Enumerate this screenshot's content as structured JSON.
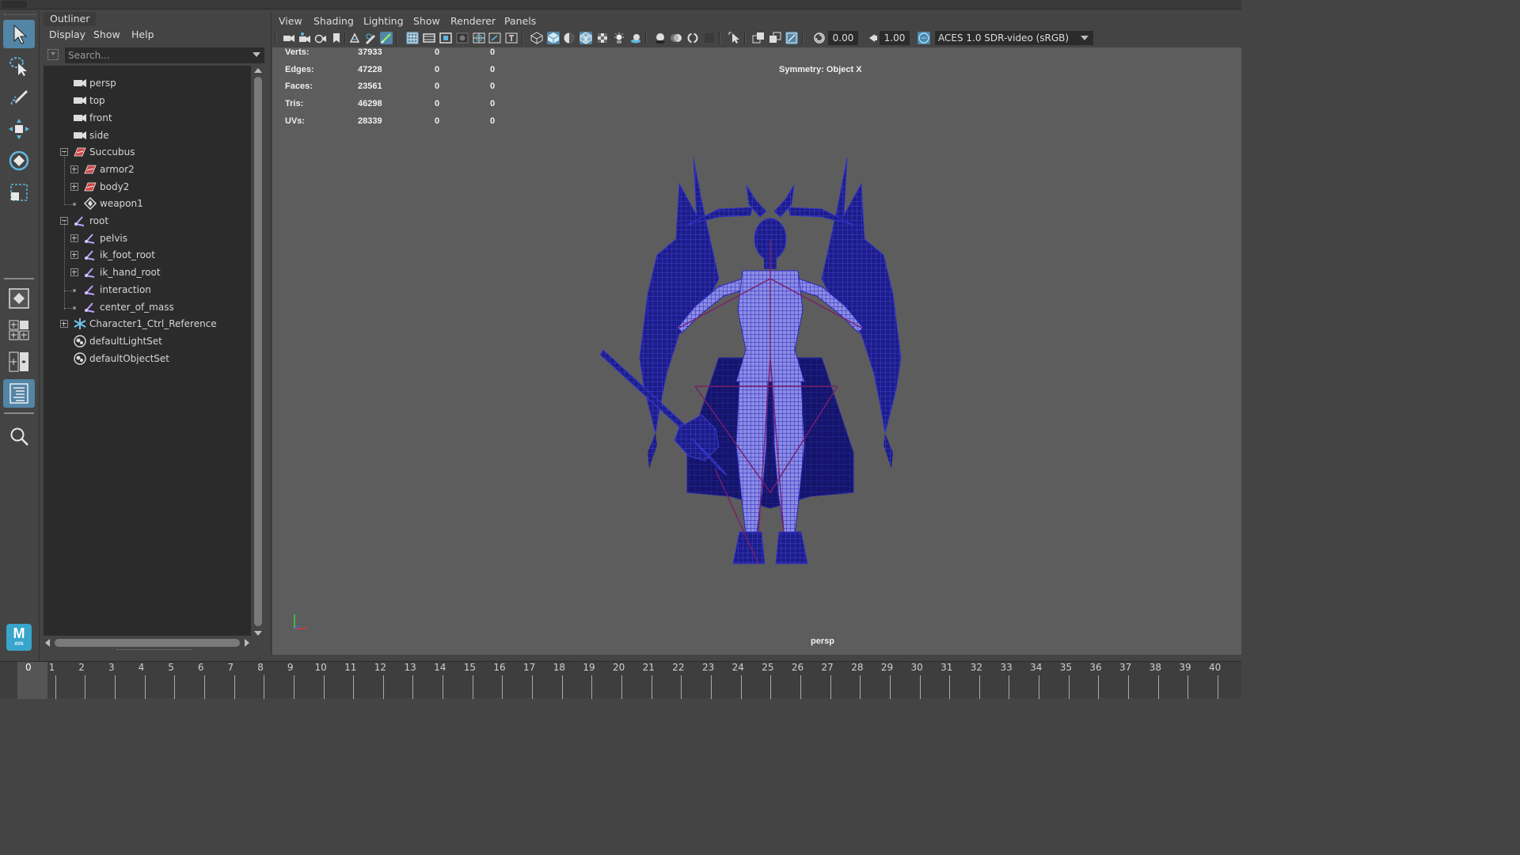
{
  "outliner": {
    "tab_label": "Outliner",
    "menus": [
      "Display",
      "Show",
      "Help"
    ],
    "search_placeholder": "Search...",
    "items": [
      {
        "label": "persp",
        "icon": "camera-icon"
      },
      {
        "label": "top",
        "icon": "camera-icon"
      },
      {
        "label": "front",
        "icon": "camera-icon"
      },
      {
        "label": "side",
        "icon": "camera-icon"
      },
      {
        "label": "Succubus",
        "icon": "mesh-group-icon"
      },
      {
        "label": "armor2",
        "icon": "mesh-group-icon"
      },
      {
        "label": "body2",
        "icon": "mesh-group-icon"
      },
      {
        "label": "weapon1",
        "icon": "mesh-transform-icon"
      },
      {
        "label": "root",
        "icon": "joint-icon"
      },
      {
        "label": "pelvis",
        "icon": "joint-icon"
      },
      {
        "label": "ik_foot_root",
        "icon": "joint-icon"
      },
      {
        "label": "ik_hand_root",
        "icon": "joint-icon"
      },
      {
        "label": "interaction",
        "icon": "joint-icon"
      },
      {
        "label": "center_of_mass",
        "icon": "joint-icon"
      },
      {
        "label": "Character1_Ctrl_Reference",
        "icon": "hik-reference-icon"
      },
      {
        "label": "defaultLightSet",
        "icon": "set-icon"
      },
      {
        "label": "defaultObjectSet",
        "icon": "set-icon"
      }
    ]
  },
  "panel": {
    "menus": [
      "View",
      "Shading",
      "Lighting",
      "Show",
      "Renderer",
      "Panels"
    ],
    "exposure": "0.00",
    "gamma": "1.00",
    "color_space": "ACES 1.0 SDR-video (sRGB)"
  },
  "hud": {
    "rows": [
      {
        "label": "Verts:",
        "v1": "37933",
        "v2": "0",
        "v3": "0"
      },
      {
        "label": "Edges:",
        "v1": "47228",
        "v2": "0",
        "v3": "0"
      },
      {
        "label": "Faces:",
        "v1": "23561",
        "v2": "0",
        "v3": "0"
      },
      {
        "label": "Tris:",
        "v1": "46298",
        "v2": "0",
        "v3": "0"
      },
      {
        "label": "UVs:",
        "v1": "28339",
        "v2": "0",
        "v3": "0"
      }
    ],
    "symmetry": "Symmetry: Object X",
    "camera": "persp"
  },
  "timeline": {
    "current_frame": "0",
    "frames": [
      "1",
      "2",
      "3",
      "4",
      "5",
      "6",
      "7",
      "8",
      "9",
      "10",
      "11",
      "12",
      "13",
      "14",
      "15",
      "16",
      "17",
      "18",
      "19",
      "20",
      "21",
      "22",
      "23",
      "24",
      "25",
      "26",
      "27",
      "28",
      "29",
      "30",
      "31",
      "32",
      "33",
      "34",
      "35",
      "36",
      "37",
      "38",
      "39",
      "40"
    ]
  },
  "colors": {
    "accent": "#5285a6",
    "viewport_bg": "#5d5d5d",
    "wireframe": "#2b2bbd",
    "logo": "#37a5cc"
  },
  "logo": {
    "letter": "M",
    "sub": "AYA"
  }
}
